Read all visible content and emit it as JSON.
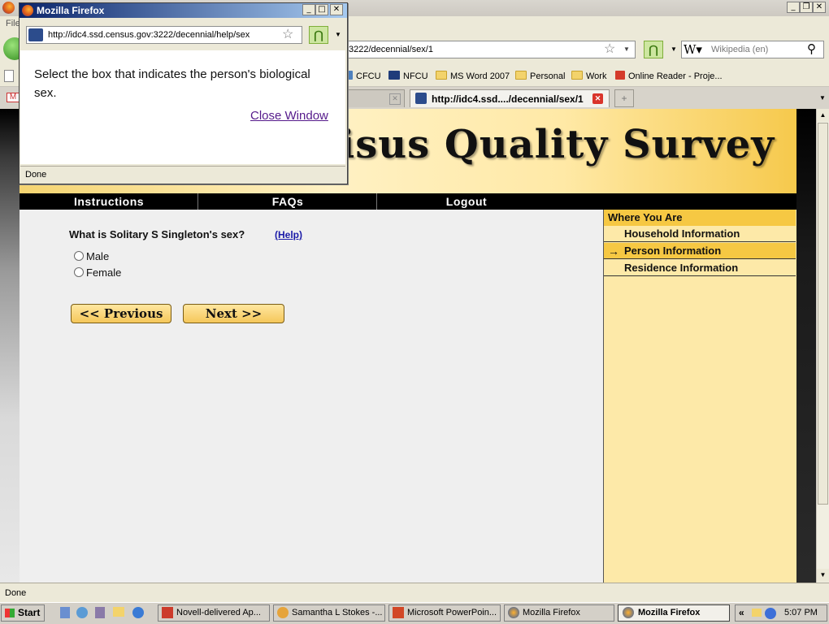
{
  "browser": {
    "status": "Done",
    "url": "3222/decennial/sex/1",
    "search_placeholder": "Wikipedia (en)",
    "menu_file": "File",
    "bookmarks": [
      "CFCU",
      "NFCU",
      "MS Word 2007",
      "Personal",
      "Work",
      "Online Reader - Proje..."
    ],
    "tab_active": "http://idc4.ssd..../decennial/sex/1",
    "colors": {
      "accent": "#f6c843",
      "link": "#1a1aa8"
    }
  },
  "banner": {
    "title_visible": "isus Quality Survey"
  },
  "topnav": [
    "Instructions",
    "FAQs",
    "Logout"
  ],
  "question": {
    "text": "What is Solitary S Singleton's sex?",
    "help": "(Help)",
    "options": [
      "Male",
      "Female"
    ]
  },
  "buttons": {
    "previous": "<< Previous",
    "next": "Next >>"
  },
  "sidebar": {
    "heading": "Where You Are",
    "items": [
      "Household Information",
      "Person Information",
      "Residence Information"
    ],
    "current": "Person Information"
  },
  "popup": {
    "title": "Mozilla Firefox",
    "url": "http://idc4.ssd.census.gov:3222/decennial/help/sex",
    "text": "Select the box that indicates the person's biological sex.",
    "close": "Close Window",
    "status": "Done"
  },
  "taskbar": {
    "start": "Start",
    "tasks": [
      "Novell-delivered Ap...",
      "Samantha L Stokes -...",
      "Microsoft PowerPoin...",
      "Mozilla Firefox",
      "Mozilla Firefox"
    ],
    "clock": "5:07 PM",
    "tray_chevron": "«"
  }
}
